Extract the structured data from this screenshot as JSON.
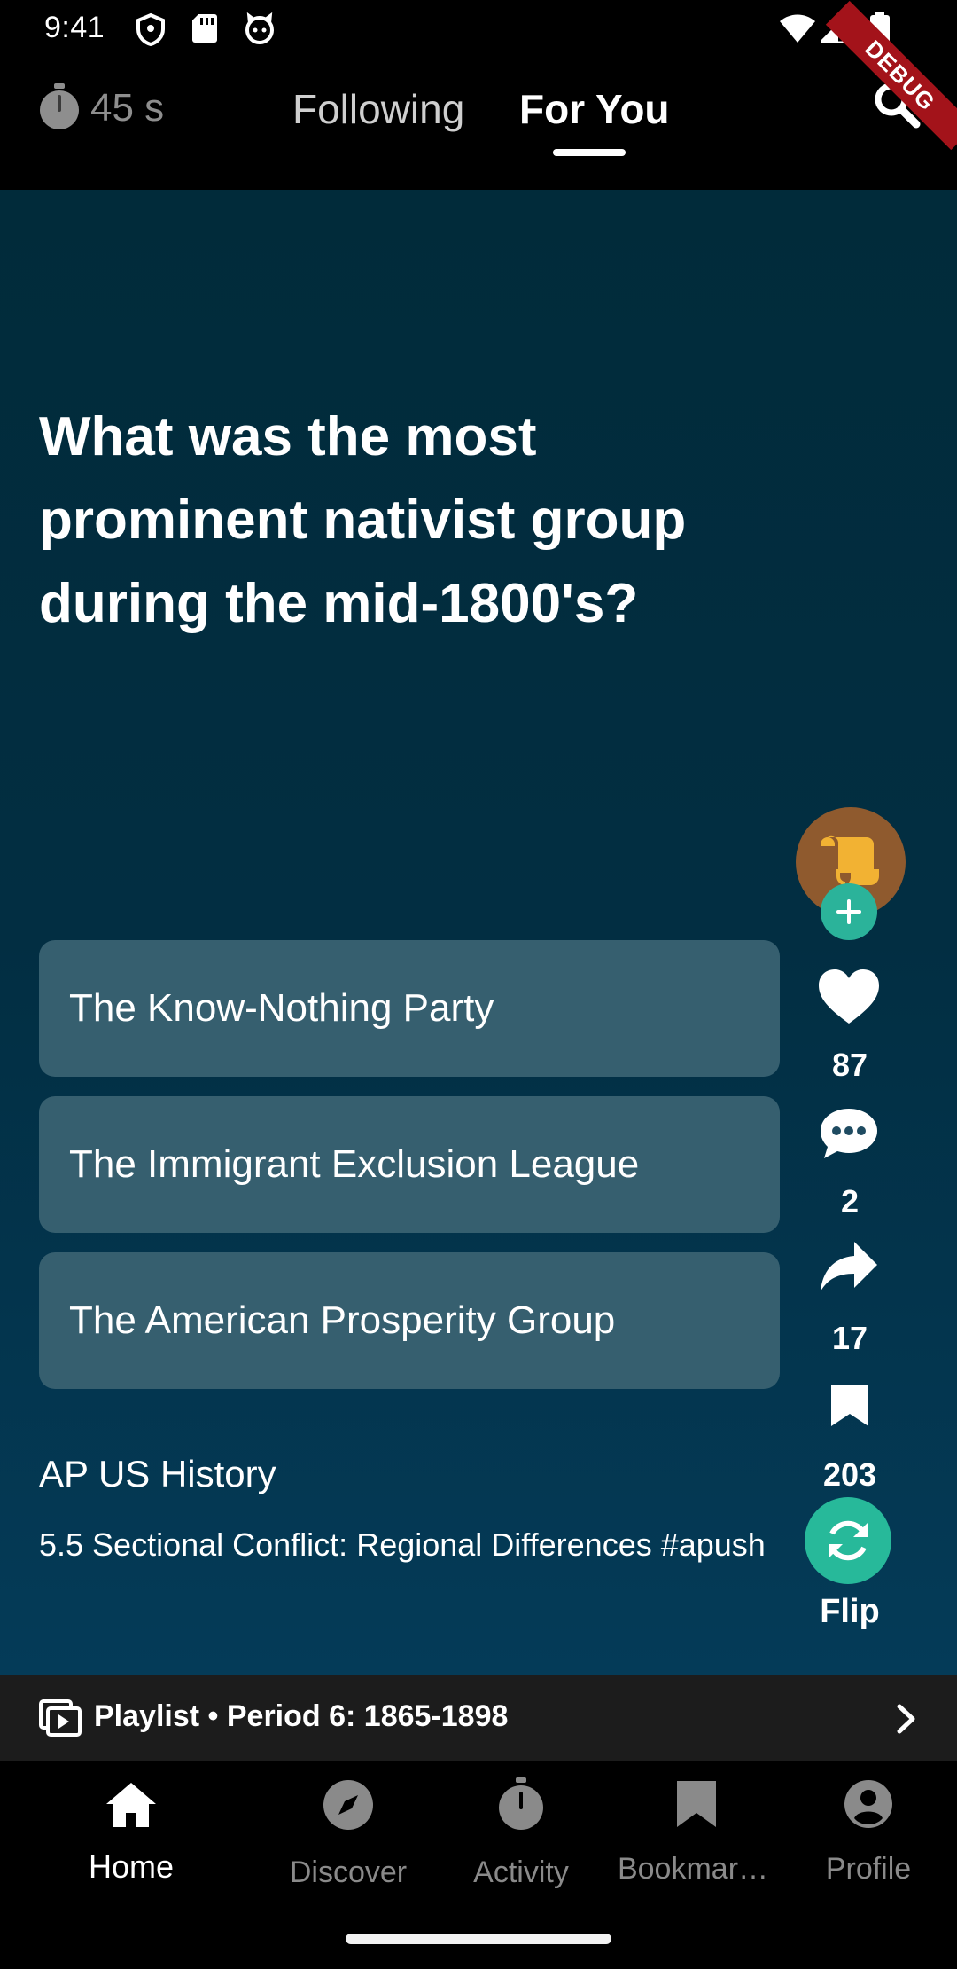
{
  "status_bar": {
    "time": "9:41"
  },
  "header": {
    "timer": "45 s",
    "tabs": [
      {
        "label": "Following",
        "active": false
      },
      {
        "label": "For You",
        "active": true
      }
    ],
    "debug_banner": "DEBUG"
  },
  "card": {
    "question": "What was the most prominent nativist group during the mid-1800's?",
    "answers": [
      "The Know-Nothing Party",
      "The Immigrant Exclusion League",
      "The American Prosperity Group"
    ],
    "course": "AP US History",
    "topic": "5.5 Sectional Conflict: Regional Differences #apush"
  },
  "actions": {
    "likes": "87",
    "comments": "2",
    "shares": "17",
    "bookmarks": "203",
    "flip_label": "Flip"
  },
  "playlist": {
    "label": "Playlist • Period 6: 1865-1898"
  },
  "bottom_nav": [
    {
      "label": "Home",
      "icon": "home-icon",
      "active": true
    },
    {
      "label": "Discover",
      "icon": "compass-icon",
      "active": false
    },
    {
      "label": "Activity",
      "icon": "stopwatch-icon",
      "active": false
    },
    {
      "label": "Bookmar…",
      "icon": "bookmark-icon",
      "active": false
    },
    {
      "label": "Profile",
      "icon": "profile-icon",
      "active": false
    }
  ],
  "colors": {
    "accent": "#2bb39a",
    "answer_bg": "#365f6f",
    "content_bg": "#022e42"
  }
}
